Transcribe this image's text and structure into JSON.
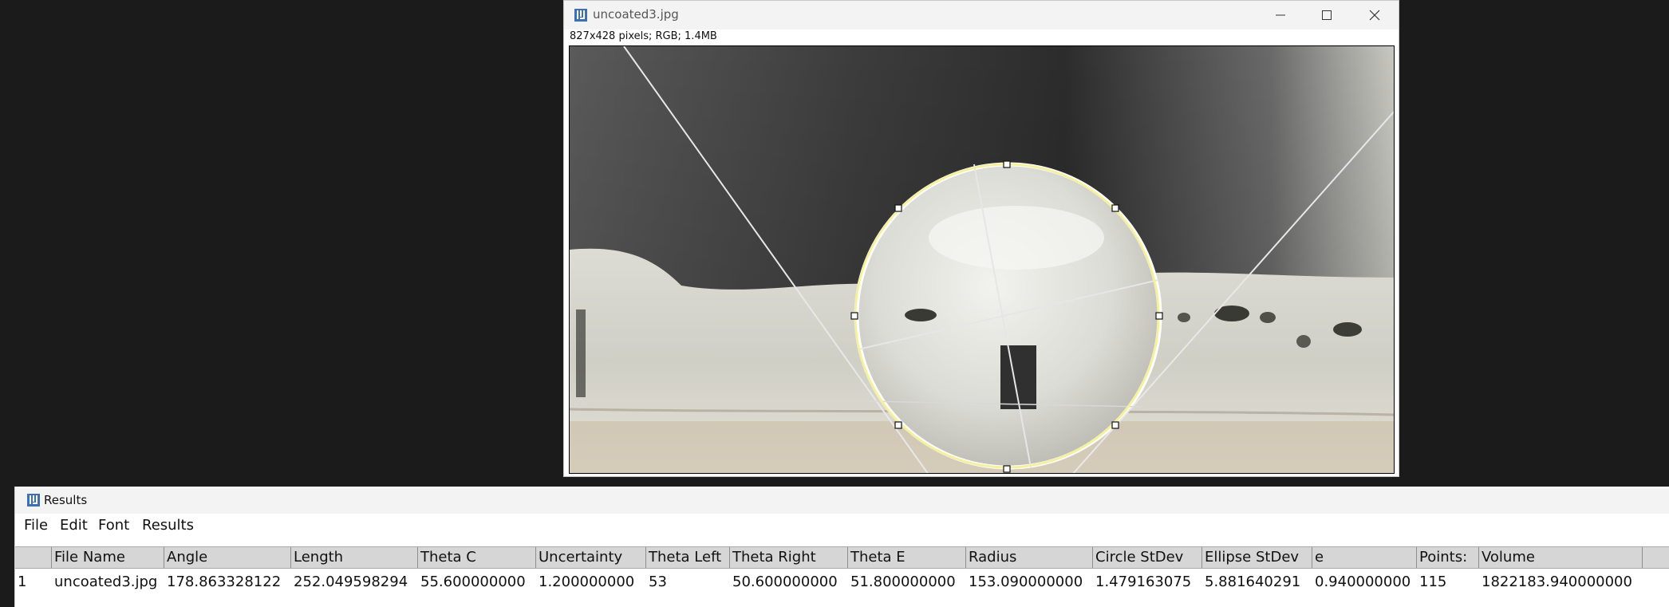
{
  "image_window": {
    "title": "uncoated3.jpg",
    "info": "827x428 pixels; RGB; 1.4MB",
    "controls": [
      "minimize",
      "maximize",
      "close"
    ]
  },
  "results_window": {
    "title": "Results",
    "menu": [
      "File",
      "Edit",
      "Font",
      "Results"
    ],
    "table": {
      "columns": [
        "",
        "File Name",
        "Angle",
        "Length",
        "Theta C",
        "Uncertainty",
        "Theta Left",
        "Theta Right",
        "Theta E",
        "Radius",
        "Circle StDev",
        "Ellipse StDev",
        "e",
        "Points:",
        "Volume"
      ],
      "rows": [
        [
          "1",
          "uncoated3.jpg",
          "178.863328122",
          "252.049598294",
          "55.600000000",
          "1.200000000",
          "53",
          "50.600000000",
          "51.800000000",
          "153.090000000",
          "1.479163075",
          "5.881640291",
          "0.940000000",
          "115",
          "1822183.940000000"
        ]
      ]
    }
  },
  "colors": {
    "desktop": "#1b1b1b",
    "titlebar": "#f3f3f3",
    "fit_circle": "#f5f0a0",
    "table_header": "#d6d6d6"
  }
}
